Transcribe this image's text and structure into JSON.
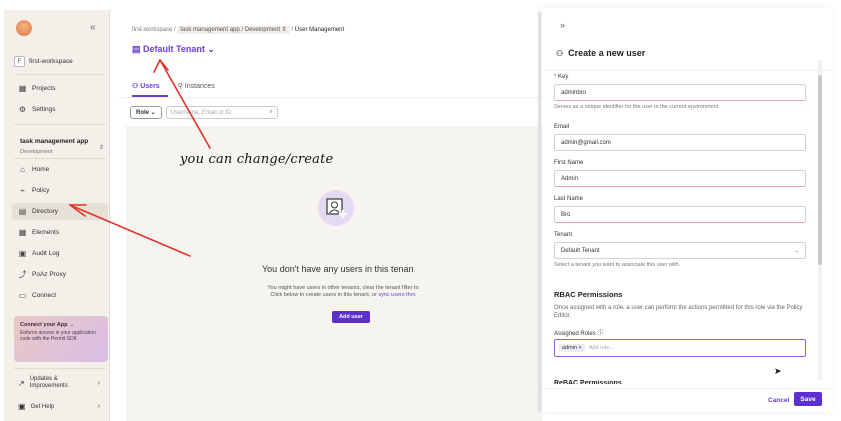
{
  "sidebar": {
    "collapse_label": "«",
    "workspace": {
      "badge": "F",
      "name": "first-workspace"
    },
    "top_items": [
      {
        "label": "Projects",
        "icon": "grid-icon"
      },
      {
        "label": "Settings",
        "icon": "gear-icon"
      }
    ],
    "app": {
      "name": "task management app",
      "env": "Development",
      "chevron": "⇕"
    },
    "nav_items": [
      {
        "label": "Home",
        "icon": "home-icon"
      },
      {
        "label": "Policy",
        "icon": "policy-icon"
      },
      {
        "label": "Directory",
        "icon": "directory-icon"
      },
      {
        "label": "Elements",
        "icon": "elements-icon"
      },
      {
        "label": "Audit Log",
        "icon": "audit-log-icon"
      },
      {
        "label": "PoAz Proxy",
        "icon": "proxy-icon"
      },
      {
        "label": "Connect",
        "icon": "connect-icon"
      }
    ],
    "promo": {
      "title": "Connect your App →",
      "desc": "Enforce access in your application code with the Permit SDK"
    },
    "bottom_items": [
      {
        "label": "Updates & Improvements",
        "arrow": "›"
      },
      {
        "label": "Get Help",
        "arrow": "›"
      }
    ]
  },
  "main": {
    "breadcrumb": {
      "workspace": "first-workspace",
      "sep1": "/",
      "app_env": "task management app / Development ⇕",
      "sep2": "/",
      "current": "User Management"
    },
    "tenant_label": "Default Tenant ⌄",
    "tabs": [
      {
        "label": "Users",
        "active": true
      },
      {
        "label": "Instances",
        "active": false
      }
    ],
    "filters": {
      "role_label": "Role ⌄",
      "search_placeholder": "Username, Email or ID"
    },
    "empty": {
      "title": "You don't have any users in this tenan",
      "desc_line1": "You might have users in other tenants, clear the tenant filter to",
      "desc_line2_prefix": "Click below to create users in this tenant, or",
      "desc_link": "sync users thro",
      "button": "Add user"
    }
  },
  "annotation": {
    "text": "you can change/create"
  },
  "drawer": {
    "collapse_label": "»",
    "title": "Create a new user",
    "fields": {
      "key": {
        "label": "Key",
        "required_mark": "*",
        "value": "adminbro",
        "help": "Serves as a unique identifier for the user in the current environment."
      },
      "email": {
        "label": "Email",
        "value": "admin@gmail.com"
      },
      "first_name": {
        "label": "First Name",
        "value": "Admin"
      },
      "last_name": {
        "label": "Last Name",
        "value": "Bro"
      },
      "tenant": {
        "label": "Tenant",
        "value": "Default Tenant",
        "help": "Select a tenant you want to associate this user with."
      }
    },
    "rbac": {
      "title": "RBAC Permissions",
      "desc": "Once assigned with a role, a user can perform the actions permitted for this role via the Policy Editor.",
      "roles_label": "Assigned Roles ⓘ",
      "chip": "admin ×",
      "placeholder": "Add role..."
    },
    "rebac_title": "ReBAC Permissions",
    "cancel": "Cancel",
    "save": "Save"
  },
  "colors": {
    "accent": "#6c3fd4",
    "primary_button": "#5b2fd0",
    "annotation_arrow": "#e0342a",
    "sidebar_bg": "#f3efe9"
  }
}
